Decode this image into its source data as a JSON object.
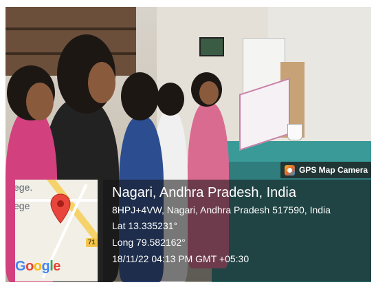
{
  "map": {
    "label_top": "ege.",
    "label_mid": "ege",
    "road_shield": "71",
    "google_logo": {
      "g1": "G",
      "o1": "o",
      "o2": "o",
      "g2": "g",
      "l": "l",
      "e": "e"
    }
  },
  "badge": {
    "label": "GPS Map Camera",
    "icon": "camera-icon"
  },
  "location": {
    "title": "Nagari, Andhra Pradesh, India",
    "address": "8HPJ+4VW, Nagari, Andhra Pradesh 517590, India",
    "lat": "Lat 13.335231°",
    "long": "Long 79.582162°",
    "timestamp": "18/11/22 04:13 PM GMT +05:30"
  }
}
